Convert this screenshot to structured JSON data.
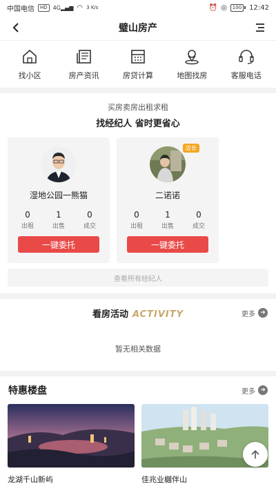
{
  "status_bar": {
    "carrier": "中国电信",
    "network_badge": "HD",
    "signal_text": "4G",
    "speed": "3 K/s",
    "battery": "100",
    "time": "12:42"
  },
  "header": {
    "title": "璧山房产",
    "back_icon": "back-arrow-icon",
    "menu_icon": "menu-icon"
  },
  "quick_nav": [
    {
      "label": "找小区",
      "icon": "house-icon"
    },
    {
      "label": "房产资讯",
      "icon": "newspaper-icon"
    },
    {
      "label": "房贷计算",
      "icon": "calculator-icon"
    },
    {
      "label": "地图找房",
      "icon": "map-person-icon"
    },
    {
      "label": "客服电话",
      "icon": "headset-icon"
    }
  ],
  "agents": {
    "subtitle": "买房卖房出租求租",
    "title": "找经纪人 省时更省心",
    "list": [
      {
        "name": "湿地公园一熊猫",
        "badge": "",
        "stats": [
          {
            "value": "0",
            "label": "出租"
          },
          {
            "value": "1",
            "label": "出售"
          },
          {
            "value": "0",
            "label": "成交"
          }
        ],
        "button": "一键委托"
      },
      {
        "name": "二诺诺",
        "badge": "店长",
        "stats": [
          {
            "value": "0",
            "label": "出租"
          },
          {
            "value": "1",
            "label": "出售"
          },
          {
            "value": "0",
            "label": "成交"
          }
        ],
        "button": "一键委托"
      }
    ],
    "view_all": "查看所有经纪人"
  },
  "activity": {
    "title": "看房活动",
    "title_en": "ACTIVITY",
    "more": "更多",
    "empty_text": "暂无相关数据"
  },
  "deals": {
    "title": "特惠楼盘",
    "more": "更多",
    "items": [
      {
        "name": "龙湖千山新屿"
      },
      {
        "name": "佳兆业樾伴山"
      }
    ]
  },
  "colors": {
    "accent_red": "#e94a48",
    "badge_orange": "#f5a623",
    "activity_gold": "#c7a86a"
  }
}
